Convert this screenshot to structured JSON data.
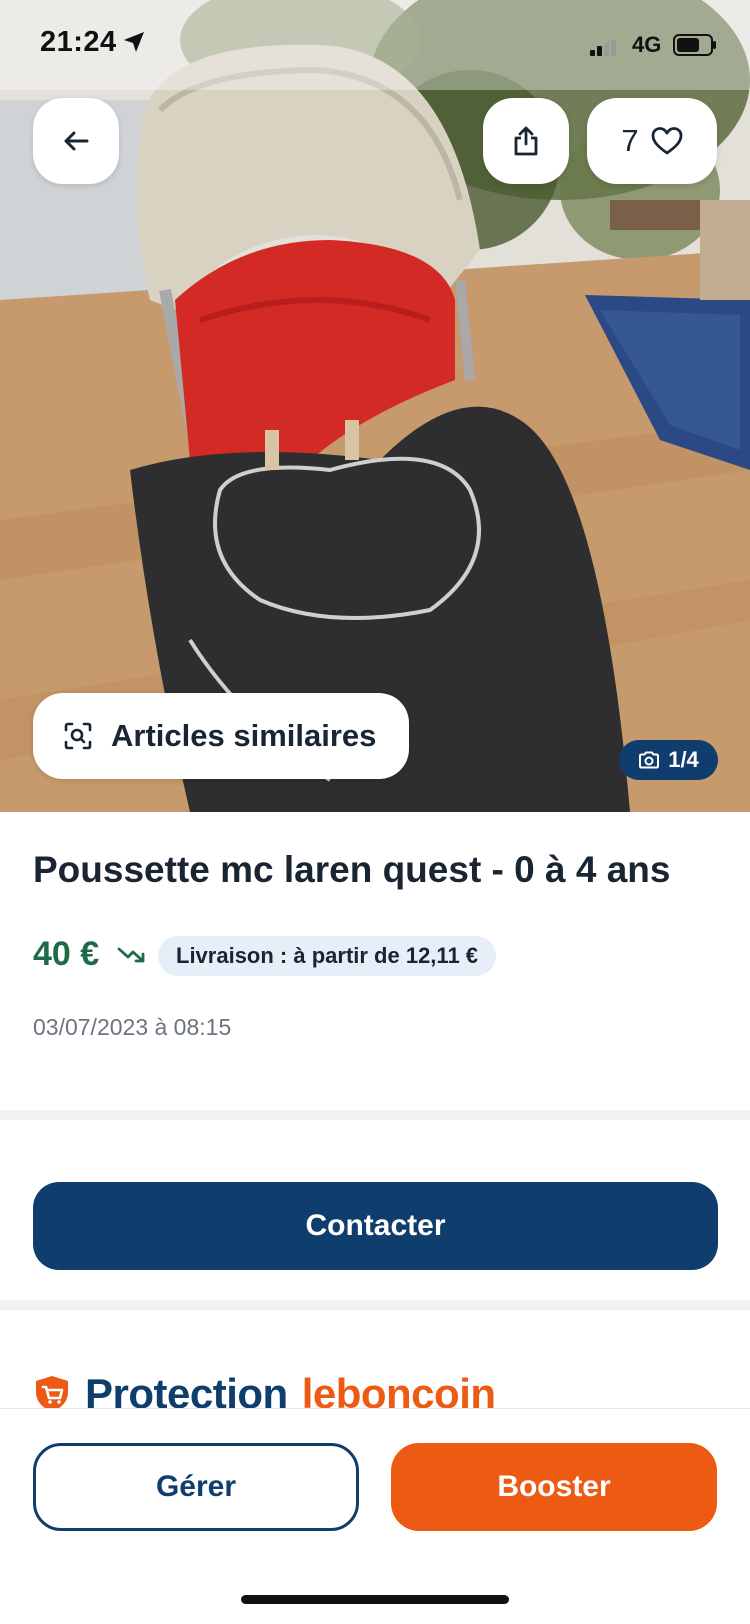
{
  "status_bar": {
    "time": "21:24",
    "network": "4G"
  },
  "header": {
    "favorites_count": "7"
  },
  "gallery": {
    "similar_label": "Articles similaires",
    "photo_counter": "1/4"
  },
  "listing": {
    "title": "Poussette mc laren quest - 0 à 4 ans",
    "price": "40 €",
    "delivery": "Livraison : à partir de 12,11 €",
    "date": "03/07/2023 à 08:15"
  },
  "actions": {
    "contact_label": "Contacter",
    "manage_label": "Gérer",
    "boost_label": "Booster"
  },
  "protection": {
    "word": "Protection",
    "brand": "leboncoin"
  },
  "colors": {
    "primary": "#0f3d6e",
    "accent": "#ec5a13",
    "price": "#1f6b48",
    "chip_bg": "#e6eef8"
  },
  "icons": {
    "back": "arrow-left-icon",
    "share": "share-icon",
    "favorite": "heart-icon",
    "similar": "image-search-icon",
    "camera": "camera-icon",
    "trend": "trend-down-icon",
    "shield": "shield-cart-icon"
  }
}
